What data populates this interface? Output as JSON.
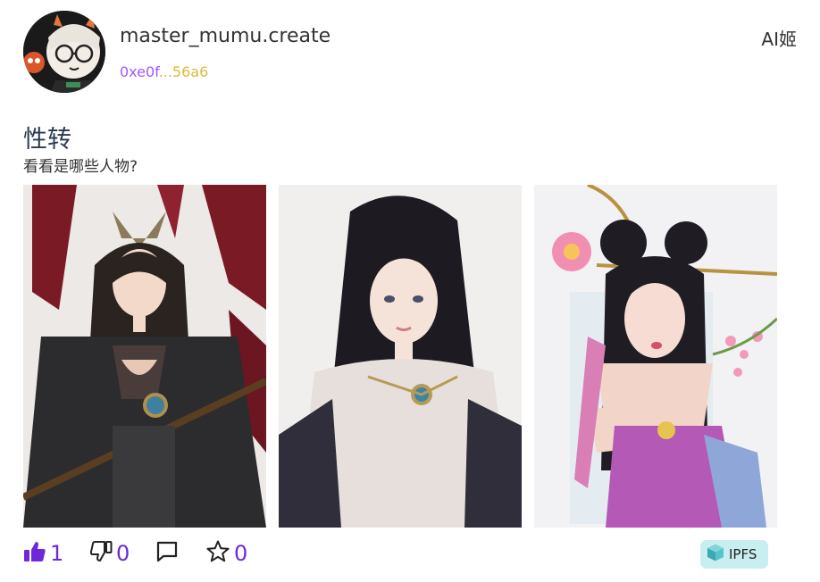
{
  "header": {
    "username": "master_mumu.create",
    "address_start": "0xe0f",
    "address_end": "...56a6",
    "category": "AI姬",
    "colors": {
      "address_start": "#a855f7",
      "address_end": "#e0b83a"
    }
  },
  "post": {
    "title": "性转",
    "description": "看看是哪些人物?",
    "images": [
      {
        "icon": "portrait-dark-armor"
      },
      {
        "icon": "portrait-white-robe"
      },
      {
        "icon": "portrait-pink-dress"
      }
    ]
  },
  "actions": {
    "likes": "1",
    "dislikes": "0",
    "favorites": "0",
    "ipfs_label": "IPFS",
    "accent": "#6d28d9"
  }
}
